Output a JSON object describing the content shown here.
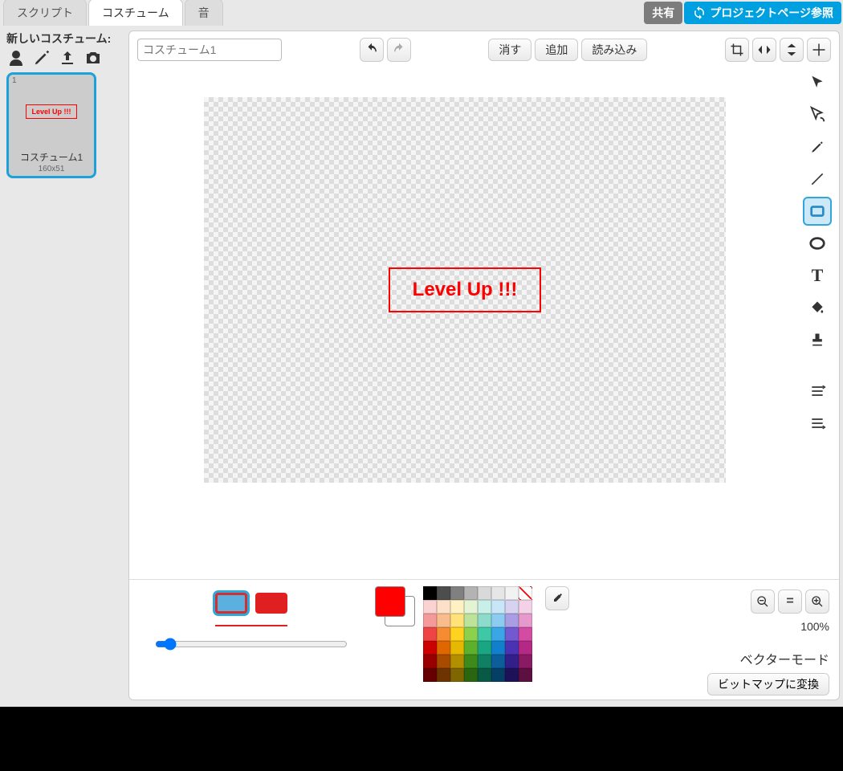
{
  "tabs": {
    "scripts": "スクリプト",
    "costumes": "コスチューム",
    "sounds": "音"
  },
  "topButtons": {
    "share": "共有",
    "projectPage": "プロジェクトページ参照"
  },
  "sidebar": {
    "title": "新しいコスチューム:",
    "thumb": {
      "num": "1",
      "text": "Level Up !!!",
      "name": "コスチューム1",
      "dim": "160x51"
    }
  },
  "editor": {
    "costumeNamePlaceholder": "コスチューム1",
    "buttons": {
      "clear": "消す",
      "add": "追加",
      "import": "読み込み"
    },
    "canvasText": "Level Up !!!"
  },
  "bottom": {
    "zoom": "100%",
    "modeLabel": "ベクターモード",
    "convertBtn": "ビットマップに変換"
  },
  "palette": [
    "#000000",
    "#4d4d4d",
    "#808080",
    "#b3b3b3",
    "#d9d9d9",
    "#e6e6e6",
    "#f2f2f2",
    "NOCOLOR",
    "#fbd2d2",
    "#fde0c8",
    "#fff2c2",
    "#e3f3d3",
    "#c9f0e8",
    "#c8e6f7",
    "#d6d2f0",
    "#f3d2e8",
    "#f59a9a",
    "#f9bd8d",
    "#ffe27a",
    "#bde39a",
    "#8ddccb",
    "#8cccf0",
    "#a99ee3",
    "#e59acb",
    "#ee4444",
    "#f58b33",
    "#ffd21f",
    "#8cd04b",
    "#3ec8a8",
    "#3aa6e8",
    "#7259d1",
    "#d44ba3",
    "#cc0000",
    "#e06600",
    "#e6b800",
    "#5cb02b",
    "#1aa683",
    "#1180cc",
    "#4a33b3",
    "#b32985",
    "#990000",
    "#a64b00",
    "#b38f00",
    "#3d8a1a",
    "#0f8064",
    "#0b5e99",
    "#321f8a",
    "#8a1a63",
    "#660000",
    "#6e3300",
    "#806600",
    "#29660f",
    "#085945",
    "#063f66",
    "#1f1159",
    "#5e0f42"
  ]
}
